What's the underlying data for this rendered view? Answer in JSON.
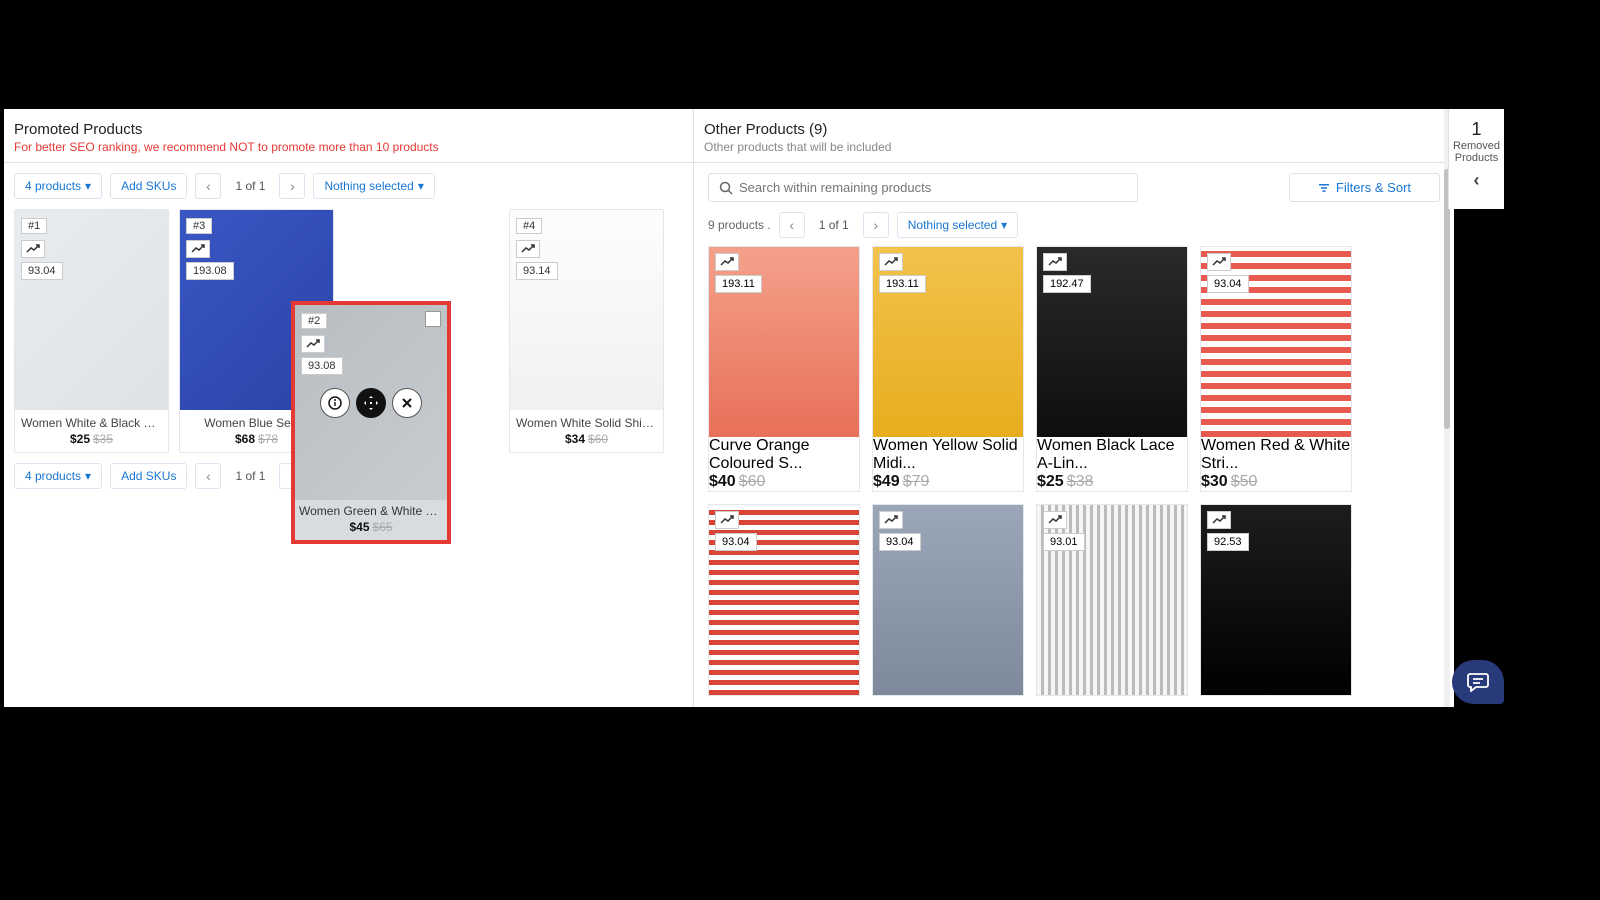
{
  "left": {
    "title": "Promoted Products",
    "subtitle": "For better SEO ranking, we recommend NOT to promote more than 10 products",
    "products_dd": "4 products",
    "add_sku": "Add SKUs",
    "page": "1 of 1",
    "nothing": "Nothing selected",
    "cards": [
      {
        "rank": "#1",
        "score": "93.04",
        "name": "Women White & Black Stri...",
        "price": "$25",
        "old": "$35"
      },
      {
        "rank": "#3",
        "score": "193.08",
        "name": "Women Blue Self-S",
        "price": "$68",
        "old": "$78"
      },
      {
        "rank": "#4",
        "score": "93.14",
        "name": "Women White Solid Shift ...",
        "price": "$34",
        "old": "$60"
      }
    ]
  },
  "drag": {
    "rank": "#2",
    "score": "93.08",
    "name": "Women Green & White Str...",
    "price": "$45",
    "old": "$65"
  },
  "right": {
    "title": "Other Products (9)",
    "subtitle": "Other products that will be included",
    "search_ph": "Search within remaining products",
    "filter": "Filters & Sort",
    "ptxt": "9 products .",
    "page": "1 of 1",
    "nothing": "Nothing selected",
    "row1": [
      {
        "score": "193.11",
        "name": "Curve Orange Coloured S...",
        "price": "$40",
        "old": "$60"
      },
      {
        "score": "193.11",
        "name": "Women Yellow Solid Midi...",
        "price": "$49",
        "old": "$79"
      },
      {
        "score": "192.47",
        "name": "Women Black Lace A-Lin...",
        "price": "$25",
        "old": "$38"
      },
      {
        "score": "93.04",
        "name": "Women Red & White Stri...",
        "price": "$30",
        "old": "$50"
      }
    ],
    "row2": [
      {
        "score": "93.04"
      },
      {
        "score": "93.04"
      },
      {
        "score": "93.01"
      },
      {
        "score": "92.53"
      }
    ]
  },
  "removed": {
    "count": "1",
    "label1": "Removed",
    "label2": "Products"
  }
}
